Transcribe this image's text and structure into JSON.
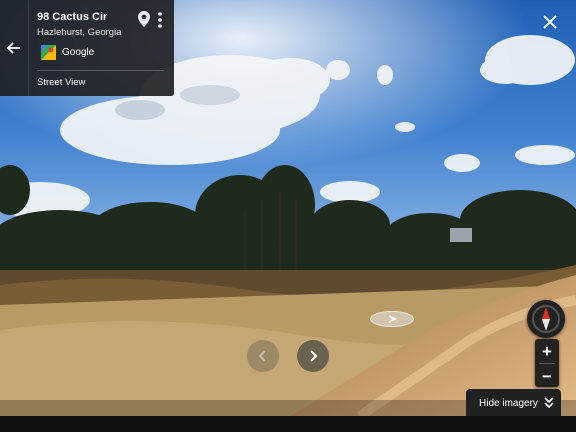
{
  "location": {
    "address": "98 Cactus Cir",
    "city": "Hazlehurst, Georgia"
  },
  "provider": "Google",
  "mode_label": "Street View",
  "controls": {
    "hide_imagery": "Hide imagery",
    "zoom_in": "+",
    "zoom_out": "−"
  },
  "icons": {
    "back": "back-arrow-icon",
    "pin": "location-pin-icon",
    "more": "more-vert-icon",
    "close": "close-icon",
    "prev": "chevron-left-icon",
    "next": "chevron-right-icon",
    "compass": "compass-icon",
    "collapse": "double-chevron-down-icon"
  },
  "colors": {
    "panel": "#202124",
    "compass_red": "#d93025",
    "sky": "#2f6bbd",
    "dirt": "#d9b07a"
  }
}
